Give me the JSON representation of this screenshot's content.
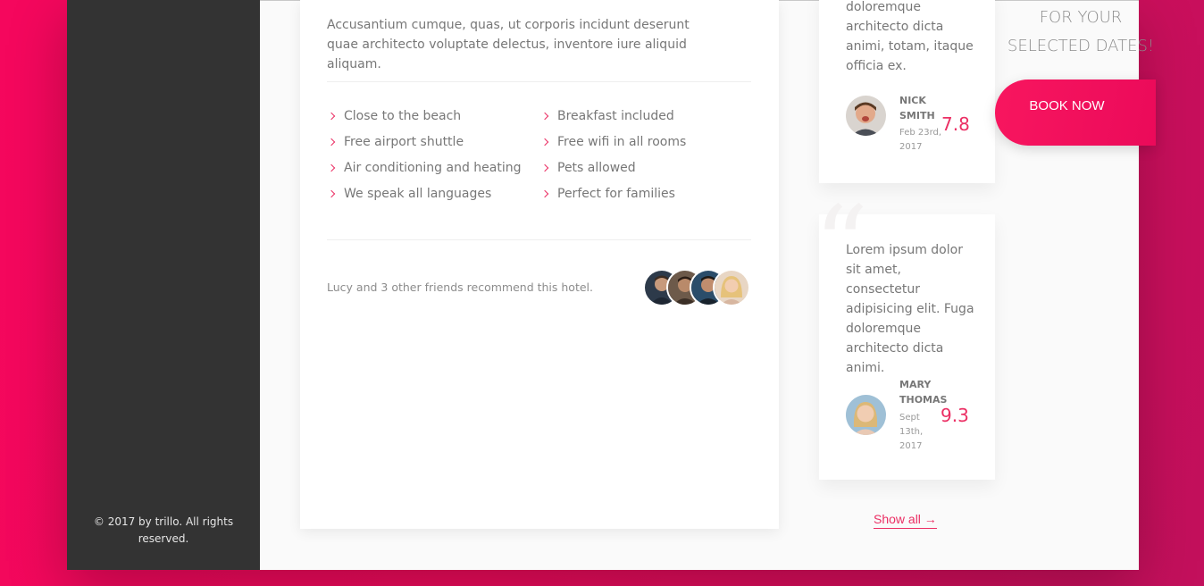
{
  "sidebar": {
    "copyright": "© 2017 by trillo. All rights reserved."
  },
  "hotel": {
    "description": "Accusantium cumque, quas, ut corporis incidunt deserunt quae architecto voluptate delectus, inventore iure aliquid aliquam.",
    "features": [
      "Close to the beach",
      "Breakfast included",
      "Free airport shuttle",
      "Free wifi in all rooms",
      "Air conditioning and heating",
      "Pets allowed",
      "We speak all languages",
      "Perfect for families"
    ],
    "recommend_text": "Lucy and 3 other friends recommend this hotel.",
    "friends_icon": "friend-avatar-icon"
  },
  "reviews": [
    {
      "text": "doloremque architecto dicta animi, totam, itaque officia ex.",
      "name": "Nick Smith",
      "date": "Feb 23rd, 2017",
      "score": "7.8"
    },
    {
      "text": "Lorem ipsum dolor sit amet, consectetur adipisicing elit. Fuga doloremque architecto dicta animi.",
      "name": "Mary Thomas",
      "date": "Sept 13th, 2017",
      "score": "9.3"
    }
  ],
  "show_all_label": "Show all →",
  "cta": {
    "text": "For your selected dates!",
    "button_label": "Book now"
  },
  "colors": {
    "accent": "#eb2f64",
    "sidebar": "#333333",
    "background_gradient_start": "#f5075d",
    "background_gradient_end": "#c2105c"
  }
}
